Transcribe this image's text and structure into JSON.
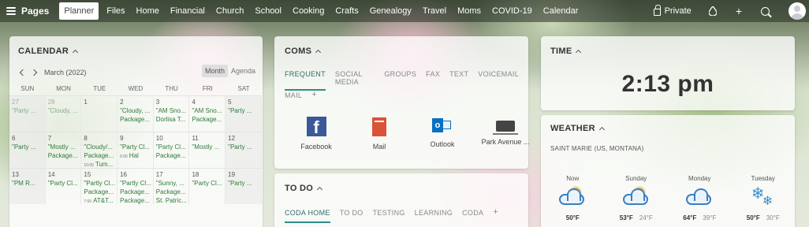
{
  "topbar": {
    "brand": "Pages",
    "nav": [
      "Planner",
      "Files",
      "Home",
      "Financial",
      "Church",
      "School",
      "Cooking",
      "Crafts",
      "Genealogy",
      "Travel",
      "Moms",
      "COVID-19",
      "Calendar"
    ],
    "active": "Planner",
    "privacy_label": "Private",
    "add_symbol": "+"
  },
  "calendar": {
    "title": "CALENDAR",
    "month": "March (2022)",
    "views": [
      "Month",
      "Agenda"
    ],
    "dow": [
      "SUN",
      "MON",
      "TUE",
      "WED",
      "THU",
      "FRI",
      "SAT"
    ],
    "weeks": [
      [
        {
          "d": "27",
          "muted": true,
          "events": [
            {
              "t": "\"Party ...",
              "dim": true
            }
          ]
        },
        {
          "d": "28",
          "muted": true,
          "events": [
            {
              "t": "\"Cloudy, ...",
              "dim": true
            }
          ]
        },
        {
          "d": "1",
          "events": []
        },
        {
          "d": "2",
          "events": [
            {
              "t": "\"Cloudy, ..."
            },
            {
              "t": "Package..."
            }
          ]
        },
        {
          "d": "3",
          "events": [
            {
              "t": "\"AM Sno..."
            },
            {
              "t": "Dorlisa T..."
            }
          ]
        },
        {
          "d": "4",
          "events": [
            {
              "t": "\"AM Sno..."
            },
            {
              "t": "Package..."
            }
          ]
        },
        {
          "d": "5",
          "events": [
            {
              "t": "\"Party ..."
            }
          ]
        }
      ],
      [
        {
          "d": "6",
          "events": [
            {
              "t": "\"Party ..."
            }
          ]
        },
        {
          "d": "7",
          "events": [
            {
              "t": "\"Mostly ..."
            },
            {
              "t": "Package..."
            }
          ]
        },
        {
          "d": "8",
          "events": [
            {
              "t": "\"Cloudy/..."
            },
            {
              "t": "Package..."
            },
            {
              "t": "Tum...",
              "time": "10:00"
            }
          ]
        },
        {
          "d": "9",
          "events": [
            {
              "t": "\"Party Cl..."
            },
            {
              "t": "Hal",
              "time": "5:00"
            }
          ]
        },
        {
          "d": "10",
          "events": [
            {
              "t": "\"Party Cl..."
            },
            {
              "t": "Package..."
            }
          ]
        },
        {
          "d": "11",
          "events": [
            {
              "t": "\"Mostly ..."
            }
          ]
        },
        {
          "d": "12",
          "events": [
            {
              "t": "\"Party ..."
            }
          ]
        }
      ],
      [
        {
          "d": "13",
          "events": [
            {
              "t": "\"PM R..."
            }
          ]
        },
        {
          "d": "14",
          "events": [
            {
              "t": "\"Party Cl..."
            }
          ]
        },
        {
          "d": "15",
          "events": [
            {
              "t": "\"Partly Cl..."
            },
            {
              "t": "Package..."
            },
            {
              "t": "AT&T...",
              "time": "7:00"
            }
          ]
        },
        {
          "d": "16",
          "events": [
            {
              "t": "\"Partly Cl..."
            },
            {
              "t": "Package..."
            },
            {
              "t": "Package..."
            },
            {
              "t": "Drive...",
              "time": "9:30"
            },
            {
              "t": "Car ...",
              "time": "10:00"
            }
          ]
        },
        {
          "d": "17",
          "events": [
            {
              "t": "\"Sunny, ..."
            },
            {
              "t": "Package..."
            },
            {
              "t": "St. Patric..."
            }
          ]
        },
        {
          "d": "18",
          "events": [
            {
              "t": "\"Party Cl..."
            }
          ]
        },
        {
          "d": "19",
          "events": [
            {
              "t": "\"Party ..."
            }
          ]
        }
      ]
    ]
  },
  "coms": {
    "title": "COMS",
    "tabs": [
      "FREQUENT",
      "SOCIAL MEDIA",
      "GROUPS",
      "FAX",
      "TEXT",
      "VOICEMAIL"
    ],
    "tabs2": [
      "MAIL"
    ],
    "add_symbol": "+",
    "apps": [
      {
        "name": "Facebook",
        "icon": "facebook-icon"
      },
      {
        "name": "Mail",
        "icon": "mail-icon"
      },
      {
        "name": "Outlook",
        "icon": "outlook-icon"
      },
      {
        "name": "Park Avenue ...",
        "icon": "park-avenue-icon"
      }
    ]
  },
  "todo": {
    "title": "TO DO",
    "tabs": [
      "CODA HOME",
      "TO DO",
      "TESTING",
      "LEARNING",
      "CODA"
    ],
    "add_symbol": "+"
  },
  "time": {
    "title": "TIME",
    "value": "2:13 pm"
  },
  "weather": {
    "title": "WEATHER",
    "location": "SAINT MARIE (US, MONTANA)",
    "days": [
      {
        "name": "Now",
        "hi": "50°F",
        "lo": "",
        "icon": "partly-cloudy-icon"
      },
      {
        "name": "Sunday",
        "hi": "53°F",
        "lo": "24°F",
        "icon": "partly-cloudy-icon"
      },
      {
        "name": "Monday",
        "hi": "64°F",
        "lo": "39°F",
        "icon": "cloudy-icon"
      },
      {
        "name": "Tuesday",
        "hi": "50°F",
        "lo": "30°F",
        "icon": "snow-icon"
      }
    ]
  }
}
